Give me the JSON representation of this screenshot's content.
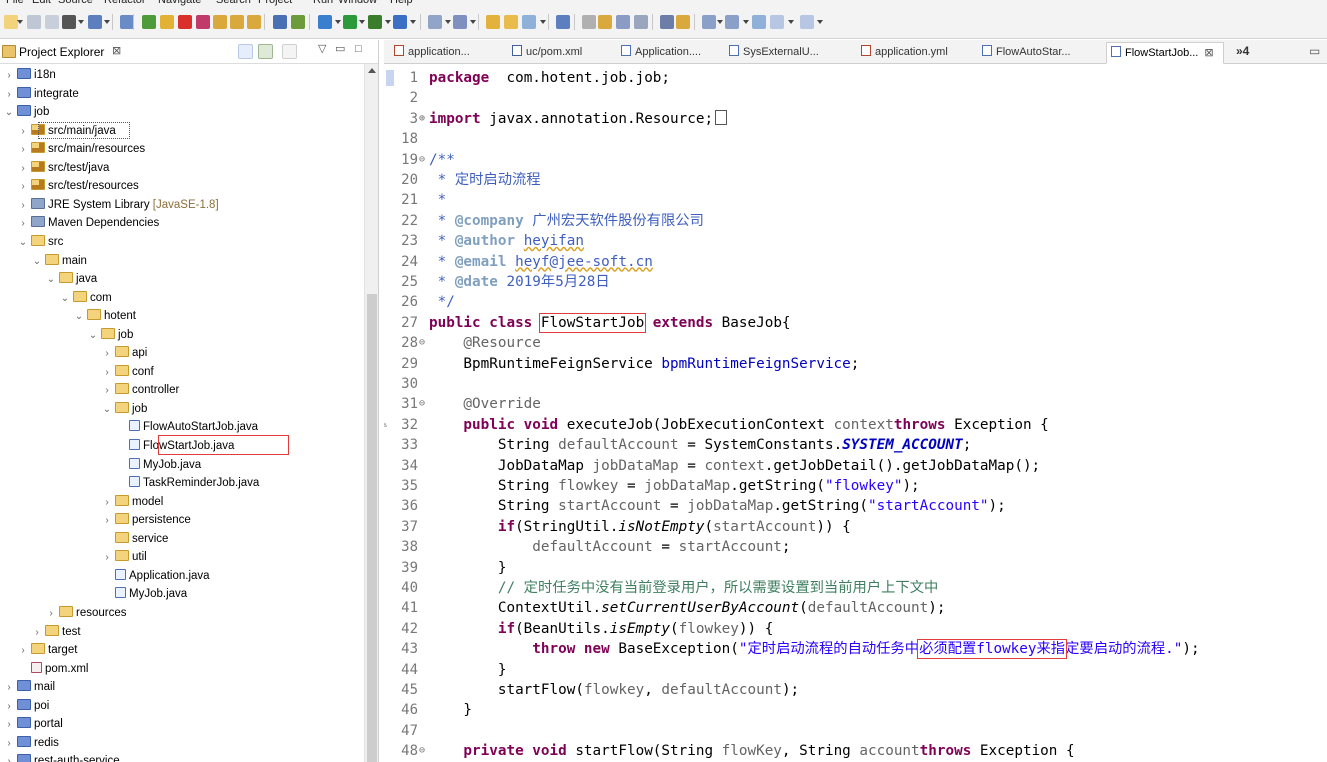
{
  "menubar": {
    "items": [
      "File",
      "Edit",
      "Source",
      "Refactor",
      "Navigate",
      "Search",
      "Project",
      "Run",
      "Window",
      "Help"
    ]
  },
  "explorer": {
    "title": "Project Explorer",
    "close": "⊠",
    "items": [
      {
        "label": "i18n",
        "icon": "project",
        "depth": 0,
        "twisty": ">"
      },
      {
        "label": "integrate",
        "icon": "project",
        "depth": 0,
        "twisty": ">"
      },
      {
        "label": "job",
        "icon": "project",
        "depth": 0,
        "twisty": "v"
      },
      {
        "label": "src/main/java",
        "icon": "source-folder",
        "depth": 1,
        "twisty": ">"
      },
      {
        "label": "src/main/resources",
        "icon": "source-folder",
        "depth": 1,
        "twisty": ">"
      },
      {
        "label": "src/test/java",
        "icon": "source-folder",
        "depth": 1,
        "twisty": ">"
      },
      {
        "label": "src/test/resources",
        "icon": "source-folder",
        "depth": 1,
        "twisty": ">"
      },
      {
        "label": "JRE System Library",
        "suffix": "[JavaSE-1.8]",
        "icon": "library",
        "depth": 1,
        "twisty": ">"
      },
      {
        "label": "Maven Dependencies",
        "icon": "library",
        "depth": 1,
        "twisty": ">"
      },
      {
        "label": "src",
        "icon": "folder",
        "depth": 1,
        "twisty": "v"
      },
      {
        "label": "main",
        "icon": "folder",
        "depth": 2,
        "twisty": "v"
      },
      {
        "label": "java",
        "icon": "folder",
        "depth": 3,
        "twisty": "v"
      },
      {
        "label": "com",
        "icon": "folder",
        "depth": 4,
        "twisty": "v"
      },
      {
        "label": "hotent",
        "icon": "folder",
        "depth": 5,
        "twisty": "v"
      },
      {
        "label": "job",
        "icon": "folder",
        "depth": 6,
        "twisty": "v"
      },
      {
        "label": "api",
        "icon": "folder",
        "depth": 7,
        "twisty": ">"
      },
      {
        "label": "conf",
        "icon": "folder",
        "depth": 7,
        "twisty": ">"
      },
      {
        "label": "controller",
        "icon": "folder",
        "depth": 7,
        "twisty": ">"
      },
      {
        "label": "job",
        "icon": "folder",
        "depth": 7,
        "twisty": "v"
      },
      {
        "label": "FlowAutoStartJob.java",
        "icon": "java",
        "depth": 8,
        "twisty": ""
      },
      {
        "label": "FlowStartJob.java",
        "icon": "java",
        "depth": 8,
        "twisty": ""
      },
      {
        "label": "MyJob.java",
        "icon": "java",
        "depth": 8,
        "twisty": ""
      },
      {
        "label": "TaskReminderJob.java",
        "icon": "java",
        "depth": 8,
        "twisty": ""
      },
      {
        "label": "model",
        "icon": "folder",
        "depth": 7,
        "twisty": ">"
      },
      {
        "label": "persistence",
        "icon": "folder",
        "depth": 7,
        "twisty": ">"
      },
      {
        "label": "service",
        "icon": "folder",
        "depth": 7,
        "twisty": ""
      },
      {
        "label": "util",
        "icon": "folder",
        "depth": 7,
        "twisty": ">"
      },
      {
        "label": "Application.java",
        "icon": "java",
        "depth": 7,
        "twisty": ""
      },
      {
        "label": "MyJob.java",
        "icon": "java",
        "depth": 7,
        "twisty": ""
      },
      {
        "label": "resources",
        "icon": "folder",
        "depth": 3,
        "twisty": ">"
      },
      {
        "label": "test",
        "icon": "folder",
        "depth": 2,
        "twisty": ">"
      },
      {
        "label": "target",
        "icon": "folder",
        "depth": 1,
        "twisty": ">"
      },
      {
        "label": "pom.xml",
        "icon": "xml",
        "depth": 1,
        "twisty": ""
      },
      {
        "label": "mail",
        "icon": "project",
        "depth": 0,
        "twisty": ">"
      },
      {
        "label": "poi",
        "icon": "project",
        "depth": 0,
        "twisty": ">"
      },
      {
        "label": "portal",
        "icon": "project",
        "depth": 0,
        "twisty": ">"
      },
      {
        "label": "redis",
        "icon": "project",
        "depth": 0,
        "twisty": ">"
      },
      {
        "label": "rest-auth-service",
        "icon": "project",
        "depth": 0,
        "twisty": ">"
      }
    ]
  },
  "tabs": [
    {
      "label": "application...",
      "icon": "yml"
    },
    {
      "label": "uc/pom.xml",
      "icon": "maven"
    },
    {
      "label": "Application....",
      "icon": "java"
    },
    {
      "label": "SysExternalU...",
      "icon": "java"
    },
    {
      "label": "application.yml",
      "icon": "yml"
    },
    {
      "label": "FlowAutoStar...",
      "icon": "java"
    },
    {
      "label": "FlowStartJob...",
      "icon": "java",
      "active": true,
      "close": "⊠"
    }
  ],
  "tab_overflow": "»4",
  "code": {
    "lines": [
      {
        "n": "1",
        "parts": [
          [
            "kw",
            "package"
          ],
          [
            "",
            "  com.hotent.job.job;"
          ]
        ]
      },
      {
        "n": "2",
        "parts": []
      },
      {
        "n": "3",
        "fold": "⊕",
        "parts": [
          [
            "kw",
            "import"
          ],
          [
            "",
            " javax.annotation.Resource;"
          ]
        ],
        "foldbox": true
      },
      {
        "n": "18",
        "parts": []
      },
      {
        "n": "19",
        "fold": "⊖",
        "parts": [
          [
            "doc",
            "/**"
          ]
        ]
      },
      {
        "n": "20",
        "parts": [
          [
            "doc",
            " * 定时启动流程"
          ]
        ]
      },
      {
        "n": "21",
        "parts": [
          [
            "doc",
            " *"
          ]
        ]
      },
      {
        "n": "22",
        "parts": [
          [
            "doc",
            " * "
          ],
          [
            "tag",
            "@company"
          ],
          [
            "doc",
            " 广州宏天软件股份有限公司"
          ]
        ]
      },
      {
        "n": "23",
        "parts": [
          [
            "doc",
            " * "
          ],
          [
            "tag",
            "@author"
          ],
          [
            "doc",
            " "
          ],
          [
            "doc uline",
            "heyifan"
          ]
        ]
      },
      {
        "n": "24",
        "parts": [
          [
            "doc",
            " * "
          ],
          [
            "tag",
            "@email"
          ],
          [
            "doc",
            " "
          ],
          [
            "doc uline",
            "heyf@jee-soft.cn"
          ]
        ]
      },
      {
        "n": "25",
        "parts": [
          [
            "doc",
            " * "
          ],
          [
            "tag",
            "@date"
          ],
          [
            "doc",
            " 2019年5月28日"
          ]
        ]
      },
      {
        "n": "26",
        "parts": [
          [
            "doc",
            " */"
          ]
        ]
      },
      {
        "n": "27",
        "parts": [
          [
            "kw",
            "public class "
          ],
          [
            "box",
            "FlowStartJob"
          ],
          [
            "kw",
            " extends "
          ],
          [
            "",
            "BaseJob{"
          ]
        ]
      },
      {
        "n": "28",
        "fold": "⊖",
        "parts": [
          [
            "ann",
            "    @Resource"
          ]
        ]
      },
      {
        "n": "29",
        "parts": [
          [
            "",
            "    BpmRuntimeFeignService "
          ],
          [
            "fld",
            "bpmRuntimeFeignService"
          ],
          [
            "",
            ";"
          ]
        ]
      },
      {
        "n": "30",
        "parts": []
      },
      {
        "n": "31",
        "fold": "⊖",
        "parts": [
          [
            "ann",
            "    @Override"
          ]
        ]
      },
      {
        "n": "32",
        "marker": "▵",
        "parts": [
          [
            "kw",
            "    public void "
          ],
          [
            "",
            "executeJob(JobExecutionContext "
          ],
          [
            "ann",
            "context"
          ],
          [
            ") "
          ],
          [
            "kw",
            "throws "
          ],
          [
            "",
            "Exception {"
          ]
        ]
      },
      {
        "n": "33",
        "parts": [
          [
            "",
            "        String "
          ],
          [
            "ann",
            "defaultAccount"
          ],
          [
            "",
            " = SystemConstants."
          ],
          [
            "cst",
            "SYSTEM_ACCOUNT"
          ],
          [
            "",
            ";"
          ]
        ]
      },
      {
        "n": "34",
        "parts": [
          [
            "",
            "        JobDataMap "
          ],
          [
            "ann",
            "jobDataMap"
          ],
          [
            "",
            " = "
          ],
          [
            "ann",
            "context"
          ],
          [
            "",
            ".getJobDetail().getJobDataMap();"
          ]
        ]
      },
      {
        "n": "35",
        "parts": [
          [
            "",
            "        String "
          ],
          [
            "ann",
            "flowkey"
          ],
          [
            "",
            " = "
          ],
          [
            "ann",
            "jobDataMap"
          ],
          [
            "",
            ".getString("
          ],
          [
            "st",
            "\"flowkey\""
          ],
          [
            "",
            ");"
          ]
        ]
      },
      {
        "n": "36",
        "parts": [
          [
            "",
            "        String "
          ],
          [
            "ann",
            "startAccount"
          ],
          [
            "",
            " = "
          ],
          [
            "ann",
            "jobDataMap"
          ],
          [
            "",
            ".getString("
          ],
          [
            "st",
            "\"startAccount\""
          ],
          [
            "",
            ");"
          ]
        ]
      },
      {
        "n": "37",
        "parts": [
          [
            "kw",
            "        if"
          ],
          [
            "",
            "(StringUtil."
          ],
          [
            "it",
            "isNotEmpty"
          ],
          [
            "",
            "("
          ],
          [
            "ann",
            "startAccount"
          ],
          [
            "",
            ")) {"
          ]
        ]
      },
      {
        "n": "38",
        "parts": [
          [
            "ann",
            "            defaultAccount"
          ],
          [
            "",
            " = "
          ],
          [
            "ann",
            "startAccount"
          ],
          [
            "",
            ";"
          ]
        ]
      },
      {
        "n": "39",
        "parts": [
          [
            "",
            "        }"
          ]
        ]
      },
      {
        "n": "40",
        "parts": [
          [
            "cm",
            "        // 定时任务中没有当前登录用户，所以需要设置到当前用户上下文中"
          ]
        ]
      },
      {
        "n": "41",
        "parts": [
          [
            "",
            "        ContextUtil."
          ],
          [
            "it",
            "setCurrentUserByAccount"
          ],
          [
            "",
            "("
          ],
          [
            "ann",
            "defaultAccount"
          ],
          [
            "",
            ");"
          ]
        ]
      },
      {
        "n": "42",
        "parts": [
          [
            "kw",
            "        if"
          ],
          [
            "",
            "(BeanUtils."
          ],
          [
            "it",
            "isEmpty"
          ],
          [
            "",
            "("
          ],
          [
            "ann",
            "flowkey"
          ],
          [
            "",
            ")) {"
          ]
        ]
      },
      {
        "n": "43",
        "parts": [
          [
            "kw",
            "            throw new "
          ],
          [
            "",
            "BaseException("
          ],
          [
            "st",
            "\"定时启动流程的自动任务中"
          ],
          [
            "st box",
            "必须配置flowkey来指"
          ],
          [
            "st",
            "定要启动的流程.\""
          ],
          [
            "",
            ");"
          ]
        ]
      },
      {
        "n": "44",
        "parts": [
          [
            "",
            "        }"
          ]
        ]
      },
      {
        "n": "45",
        "parts": [
          [
            "",
            "        startFlow("
          ],
          [
            "ann",
            "flowkey"
          ],
          [
            "",
            ", "
          ],
          [
            "ann",
            "defaultAccount"
          ],
          [
            "",
            ");"
          ]
        ]
      },
      {
        "n": "46",
        "parts": [
          [
            "",
            "    }"
          ]
        ]
      },
      {
        "n": "47",
        "parts": []
      },
      {
        "n": "48",
        "fold": "⊖",
        "parts": [
          [
            "kw",
            "    private void "
          ],
          [
            "",
            "startFlow(String "
          ],
          [
            "ann",
            "flowKey"
          ],
          [
            "",
            ", String "
          ],
          [
            "ann",
            "account"
          ],
          [
            ") "
          ],
          [
            "kw",
            "throws "
          ],
          [
            "",
            "Exception {"
          ]
        ]
      }
    ]
  }
}
